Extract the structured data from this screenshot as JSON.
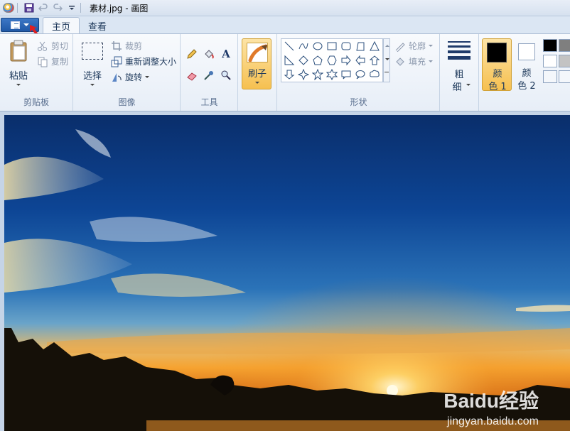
{
  "window": {
    "title": "素材.jpg - 画图"
  },
  "tabs": [
    {
      "label": "主页",
      "active": true
    },
    {
      "label": "查看",
      "active": false
    }
  ],
  "clipboard": {
    "paste_label": "粘贴",
    "cut_label": "剪切",
    "copy_label": "复制",
    "group_label": "剪贴板"
  },
  "image_group": {
    "select_label": "选择",
    "crop_label": "裁剪",
    "resize_label": "重新调整大小",
    "rotate_label": "旋转",
    "group_label": "图像"
  },
  "tools": {
    "group_label": "工具",
    "text_glyph": "A"
  },
  "brushes": {
    "label": "刷子"
  },
  "shapes": {
    "outline_label": "轮廓",
    "fill_label": "填充",
    "group_label": "形状"
  },
  "size": {
    "label_line1": "粗",
    "label_line2": "细"
  },
  "colors": {
    "color1_line1": "颜",
    "color1_line2": "色 1",
    "color2_line1": "颜",
    "color2_line2": "色 2",
    "color1_value": "#000000",
    "color2_value": "#ffffff",
    "palette": [
      "#000000",
      "#7f7f7f",
      "#ffffff",
      "#c3c3c3"
    ]
  },
  "watermark": {
    "brand": "Baidu经验",
    "url": "jingyan.baidu.com"
  },
  "accent": {
    "file_button": "#2a65b3",
    "brush_active": "#f7c45b",
    "red_arrow": "#e02020"
  }
}
